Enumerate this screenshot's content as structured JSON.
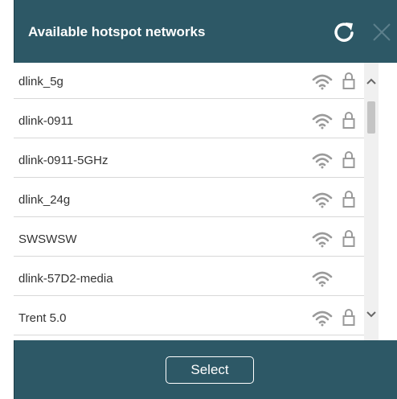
{
  "dialog": {
    "title": "Available hotspot networks",
    "refresh_icon": "refresh-icon",
    "close_icon": "close-icon"
  },
  "networks": [
    {
      "name": "dlink_5g",
      "signal_icon": "wifi-icon",
      "secured": true
    },
    {
      "name": "dlink-0911",
      "signal_icon": "wifi-icon",
      "secured": true
    },
    {
      "name": "dlink-0911-5GHz",
      "signal_icon": "wifi-icon",
      "secured": true
    },
    {
      "name": "dlink_24g",
      "signal_icon": "wifi-icon",
      "secured": true
    },
    {
      "name": "SWSWSW",
      "signal_icon": "wifi-icon",
      "secured": true
    },
    {
      "name": "dlink-57D2-media",
      "signal_icon": "wifi-icon",
      "secured": false
    },
    {
      "name": "Trent 5.0",
      "signal_icon": "wifi-icon",
      "secured": true
    }
  ],
  "footer": {
    "select_label": "Select"
  },
  "colors": {
    "panel_background": "#2d5866",
    "list_background": "#ffffff",
    "icon_gray": "#9a9a9a"
  }
}
